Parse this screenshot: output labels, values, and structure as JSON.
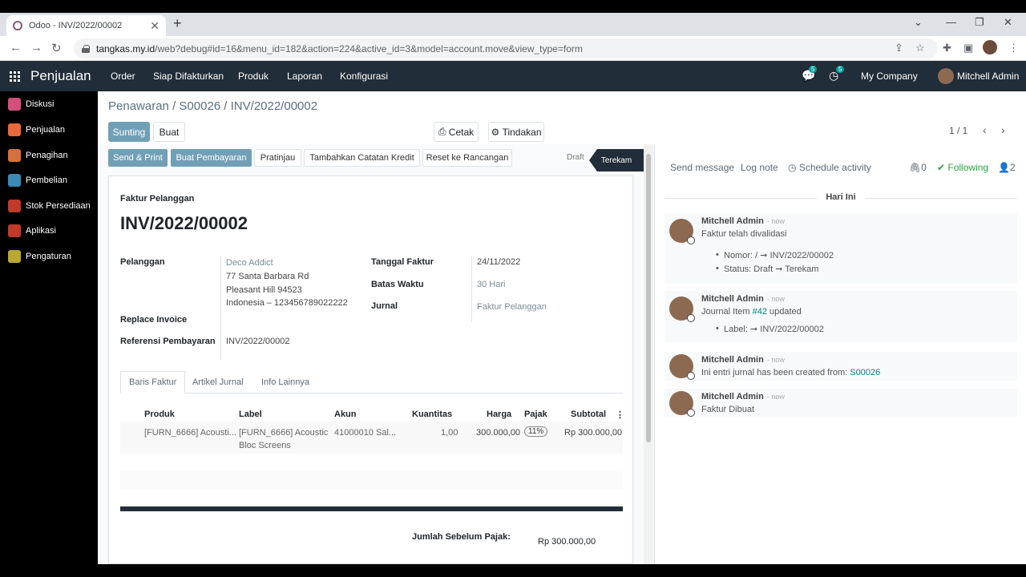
{
  "browser": {
    "tab_title": "Odoo - INV/2022/00002",
    "url_host": "tangkas.my.id",
    "url_path": "/web?debug#id=16&menu_id=182&action=224&active_id=3&model=account.move&view_type=form"
  },
  "navbar": {
    "app": "Penjualan",
    "menus": [
      "Order",
      "Siap Difakturkan",
      "Produk",
      "Laporan",
      "Konfigurasi"
    ],
    "messages_count": "5",
    "activities_count": "5",
    "company": "My Company",
    "user": "Mitchell Admin"
  },
  "sidebar": {
    "items": [
      {
        "label": "Diskusi",
        "color": "#d3507b"
      },
      {
        "label": "Penjualan",
        "color": "#e8693c"
      },
      {
        "label": "Penagihan",
        "color": "#d86f3e"
      },
      {
        "label": "Pembelian",
        "color": "#3c8ab5"
      },
      {
        "label": "Stok Persediaan",
        "color": "#c0392b"
      },
      {
        "label": "Aplikasi",
        "color": "#c0392b"
      },
      {
        "label": "Pengaturan",
        "color": "#b8a82f"
      }
    ]
  },
  "breadcrumb": {
    "part1": "Penawaran",
    "part2": "S00026",
    "part3": "INV/2022/00002"
  },
  "control": {
    "edit": "Sunting",
    "create": "Buat",
    "print": "Cetak",
    "action": "Tindakan",
    "pager": "1 / 1"
  },
  "actions": {
    "send_print": "Send & Print",
    "register_payment": "Buat Pembayaran",
    "preview": "Pratinjau",
    "credit_note": "Tambahkan Catatan Kredit",
    "reset_draft": "Reset ke Rancangan",
    "status_draft": "Draft",
    "status_posted": "Terekam"
  },
  "invoice": {
    "type": "Faktur Pelanggan",
    "name": "INV/2022/00002",
    "customer_label": "Pelanggan",
    "customer_name": "Deco Addict",
    "addr1": "77 Santa Barbara Rd",
    "addr2": "Pleasant Hill 94523",
    "addr3": "Indonesia – 123456789022222",
    "replace_label": "Replace Invoice",
    "ref_label": "Referensi Pembayaran",
    "ref_value": "INV/2022/00002",
    "date_label": "Tanggal Faktur",
    "date_value": "24/11/2022",
    "due_label": "Batas Waktu",
    "due_value": "30 Hari",
    "journal_label": "Jurnal",
    "journal_value": "Faktur Pelanggan"
  },
  "tabs": [
    "Baris Faktur",
    "Artikel Jurnal",
    "Info Lainnya"
  ],
  "lines": {
    "headers": {
      "product": "Produk",
      "label": "Label",
      "account": "Akun",
      "qty": "Kuantitas",
      "price": "Harga",
      "tax": "Pajak",
      "subtotal": "Subtotal"
    },
    "row": {
      "product": "[FURN_6666] Acousti...",
      "label1": "[FURN_6666] Acoustic",
      "label2": "Bloc Screens",
      "account": "41000010 Sal...",
      "qty": "1,00",
      "price": "300.000,00",
      "tax": "11%",
      "subtotal": "Rp 300.000,00"
    }
  },
  "totals": {
    "untaxed_label": "Jumlah Sebelum Pajak:",
    "untaxed_value": "Rp 300.000,00"
  },
  "chatter": {
    "send_message": "Send message",
    "log_note": "Log note",
    "schedule": "Schedule activity",
    "attachments": "0",
    "following": "Following",
    "followers": "2",
    "date_sep": "Hari Ini",
    "messages": [
      {
        "author": "Mitchell Admin",
        "time": "- now",
        "body": "Faktur telah divalidasi",
        "li1": "Nomor: / ➞ INV/2022/00002",
        "li2": "Status: Draft ➞ Terekam"
      },
      {
        "author": "Mitchell Admin",
        "time": "- now",
        "body_pre": "Journal Item ",
        "body_link": "#42",
        "body_post": " updated",
        "li1": "Label: ➞ INV/2022/00002"
      },
      {
        "author": "Mitchell Admin",
        "time": "- now",
        "body_pre": "Ini entri jurnal has been created from: ",
        "body_link": "S00026"
      },
      {
        "author": "Mitchell Admin",
        "time": "- now",
        "body": "Faktur Dibuat"
      }
    ]
  }
}
